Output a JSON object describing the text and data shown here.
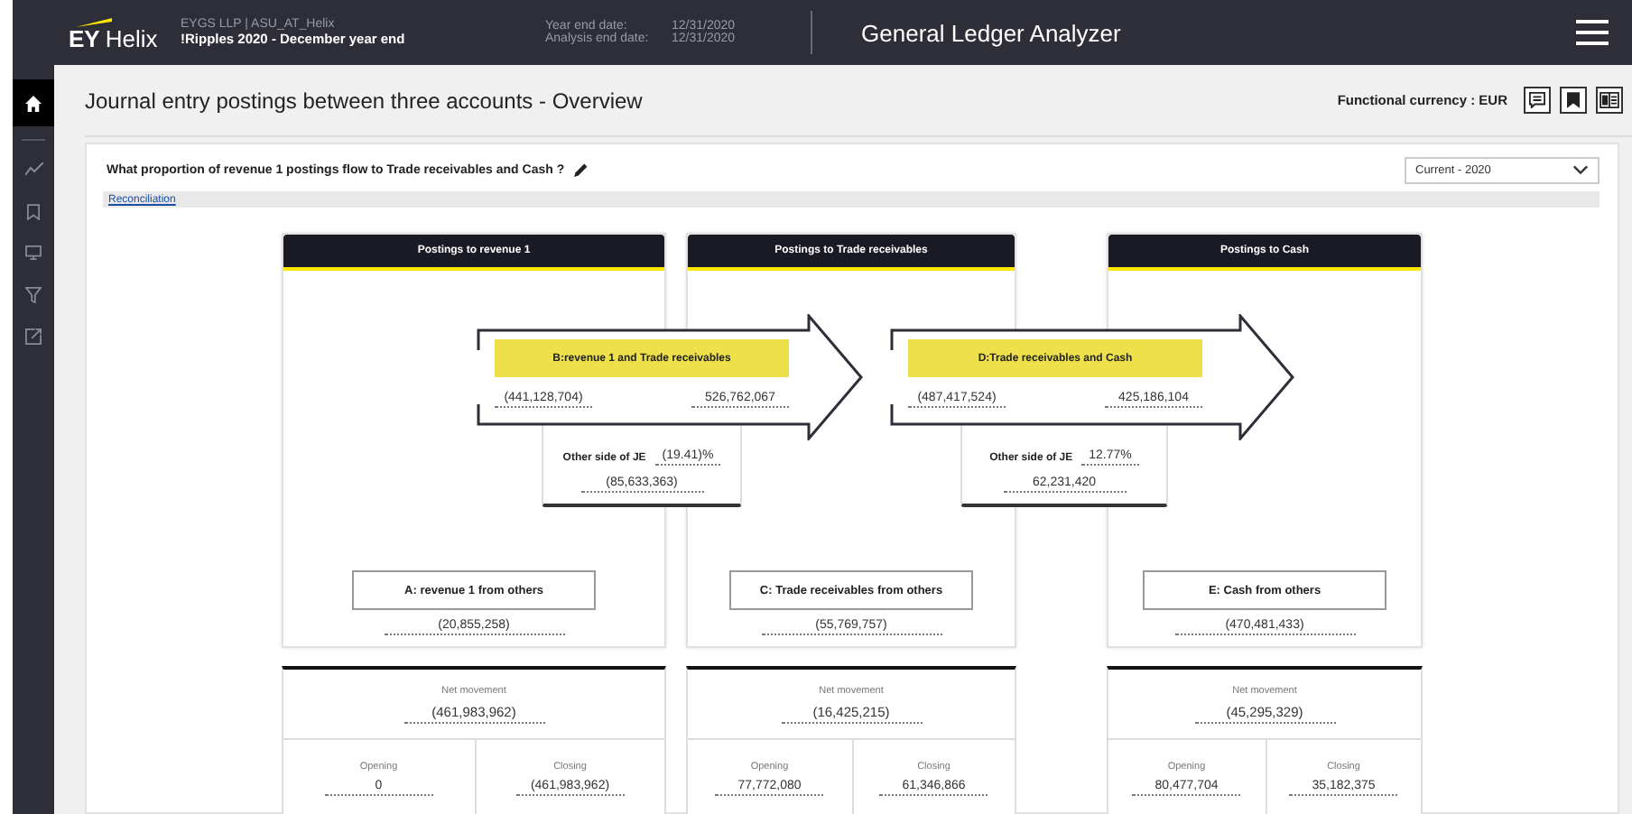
{
  "topbar": {
    "brand": "EY",
    "product": "Helix",
    "client": "EYGS LLP | ASU_AT_Helix",
    "engagement": "!Ripples 2020 - December year end",
    "dates": [
      {
        "label": "Year end date:",
        "value": "12/31/2020"
      },
      {
        "label": "Analysis end date:",
        "value": "12/31/2020"
      }
    ],
    "app_title": "General Ledger Analyzer"
  },
  "sidebar": {
    "items": [
      {
        "kind": "home",
        "selected": true
      },
      {
        "kind": "trend",
        "selected": false
      },
      {
        "kind": "bookmark",
        "selected": false
      },
      {
        "kind": "monitor",
        "selected": false
      },
      {
        "kind": "filter",
        "selected": false
      },
      {
        "kind": "export",
        "selected": false
      }
    ]
  },
  "page": {
    "title": "Journal entry postings between three accounts - Overview",
    "currency": "Functional currency : EUR"
  },
  "question": "What proportion of revenue 1 postings flow to Trade receivables and Cash ?",
  "period": "Current - 2020",
  "link": "Reconciliation",
  "accounts": [
    {
      "title": "Postings to revenue 1",
      "others_label": "A: revenue 1 from others",
      "others_value": "(20,855,258)",
      "net_label": "Net movement",
      "net_value": "(461,983,962)",
      "opening_label": "Opening",
      "opening_value": "0",
      "closing_label": "Closing",
      "closing_value": "(461,983,962)"
    },
    {
      "title": "Postings to Trade receivables",
      "others_label": "C: Trade receivables from others",
      "others_value": "(55,769,757)",
      "net_label": "Net movement",
      "net_value": "(16,425,215)",
      "opening_label": "Opening",
      "opening_value": "77,772,080",
      "closing_label": "Closing",
      "closing_value": "61,346,866"
    },
    {
      "title": "Postings to Cash",
      "others_label": "E: Cash from others",
      "others_value": "(470,481,433)",
      "net_label": "Net movement",
      "net_value": "(45,295,329)",
      "opening_label": "Opening",
      "opening_value": "80,477,704",
      "closing_label": "Closing",
      "closing_value": "35,182,375"
    }
  ],
  "flows": [
    {
      "label": "B:revenue 1 and Trade receivables",
      "from_value": "(441,128,704)",
      "to_value": "526,762,067",
      "other_label": "Other side of JE",
      "other_pct": "(19.41)%",
      "other_value": "(85,633,363)"
    },
    {
      "label": "D:Trade receivables and Cash",
      "from_value": "(487,417,524)",
      "to_value": "425,186,104",
      "other_label": "Other side of JE",
      "other_pct": "12.77%",
      "other_value": "62,231,420"
    }
  ]
}
